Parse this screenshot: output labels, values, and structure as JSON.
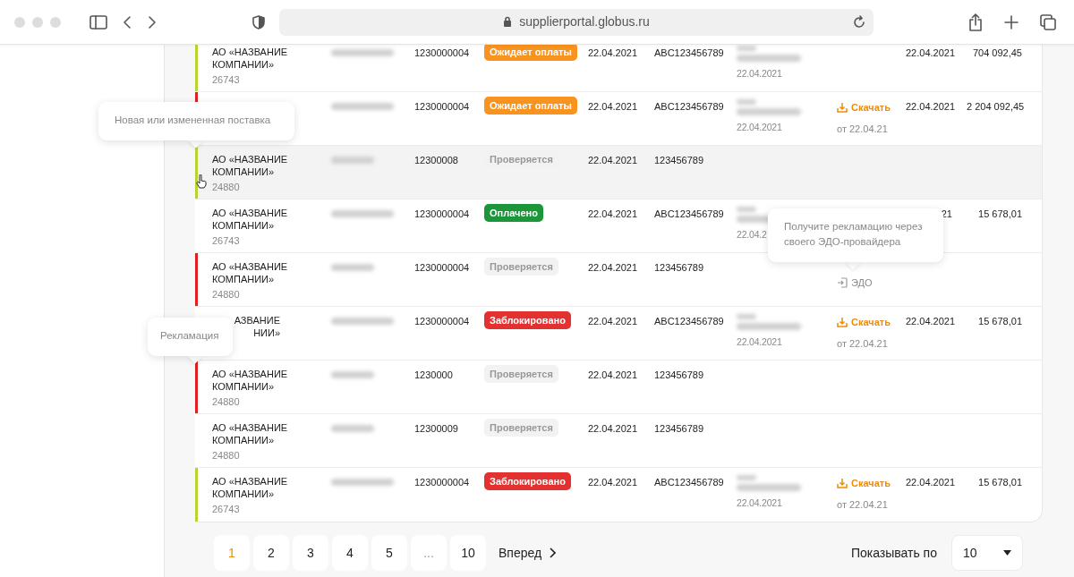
{
  "browser": {
    "url": "supplierportal.globus.ru"
  },
  "rows": [
    {
      "color": "#b7d433",
      "highlighted": false,
      "company": [
        "АО «НАЗВАНИЕ",
        "КОМПАНИИ»"
      ],
      "code": "26743",
      "column_2_redacted": true,
      "number": "1230000004",
      "status": {
        "text": "Ожидает оплаты",
        "kind": "awaiting"
      },
      "date": "22.04.2021",
      "doc": "ABC123456789",
      "column_6": {
        "redacted": true,
        "date": "22.04.2021"
      },
      "date_2": "22.04.2021",
      "amount": "704 092,45"
    },
    {
      "color": "#e02020",
      "highlighted": false,
      "column_2_redacted": true,
      "number": "1230000004",
      "status": {
        "text": "Ожидает оплаты",
        "kind": "awaiting"
      },
      "date": "22.04.2021",
      "doc": "ABC123456789",
      "column_6": {
        "redacted": true,
        "date": "22.04.2021"
      },
      "file": {
        "kind": "download",
        "text": "Скачать",
        "note": "от 22.04.21"
      },
      "date_2": "22.04.2021",
      "amount": "2 204 092,45"
    },
    {
      "color": "#b7d433",
      "highlighted": true,
      "company": [
        "АО «НАЗВАНИЕ",
        "КОМПАНИИ»"
      ],
      "code": "24880",
      "column_2_redacted": true,
      "number": "12300008",
      "status": {
        "text": "Проверяется",
        "kind": "checking"
      },
      "date": "22.04.2021",
      "doc": "123456789"
    },
    {
      "highlighted": false,
      "company": [
        "АО «НАЗВАНИЕ",
        "КОМПАНИИ»"
      ],
      "code": "26743",
      "column_2_redacted": true,
      "number": "1230000004",
      "status": {
        "text": "Оплачено",
        "kind": "paid"
      },
      "date": "22.04.2021",
      "doc": "ABC123456789",
      "column_6": {
        "redacted": true,
        "date": "22.04.2"
      },
      "date_2": "21",
      "date_2_covered": true,
      "amount": "15 678,01"
    },
    {
      "color": "#e02020",
      "highlighted": false,
      "company": [
        "АО «НАЗВАНИЕ",
        "КОМПАНИИ»"
      ],
      "code": "24880",
      "column_2_redacted": true,
      "number": "1230000004",
      "status": {
        "text": "Проверяется",
        "kind": "checking"
      },
      "date": "22.04.2021",
      "doc": "123456789",
      "file": {
        "kind": "edo",
        "text": "ЭДО"
      }
    },
    {
      "highlighted": false,
      "company": [
        "АЗВАНИЕ",
        "НИИ»"
      ],
      "company_covered": true,
      "column_2_redacted": true,
      "number": "1230000004",
      "status": {
        "text": "Заблокировано",
        "kind": "blocked"
      },
      "date": "22.04.2021",
      "doc": "ABC123456789",
      "column_6": {
        "redacted": true,
        "date": "22.04.2021"
      },
      "file": {
        "kind": "download",
        "text": "Скачать",
        "note": "от 22.04.21"
      },
      "date_2": "22.04.2021",
      "amount": "15 678,01"
    },
    {
      "color": "#e02020",
      "highlighted": false,
      "company": [
        "АО «НАЗВАНИЕ",
        "КОМПАНИИ»"
      ],
      "code": "24880",
      "column_2_redacted": true,
      "number": "1230000",
      "status": {
        "text": "Проверяется",
        "kind": "checking"
      },
      "date": "22.04.2021",
      "doc": "123456789"
    },
    {
      "highlighted": false,
      "company": [
        "АО «НАЗВАНИЕ",
        "КОМПАНИИ»"
      ],
      "code": "24880",
      "column_2_redacted": true,
      "number": "12300009",
      "status": {
        "text": "Проверяется",
        "kind": "checking"
      },
      "date": "22.04.2021",
      "doc": "123456789"
    },
    {
      "color": "#b7d433",
      "highlighted": false,
      "company": [
        "АО «НАЗВАНИЕ",
        "КОМПАНИИ»"
      ],
      "code": "26743",
      "column_2_redacted": true,
      "number": "1230000004",
      "status": {
        "text": "Заблокировано",
        "kind": "blocked"
      },
      "date": "22.04.2021",
      "doc": "ABC123456789",
      "column_6": {
        "redacted": true,
        "date": "22.04.2021"
      },
      "file": {
        "kind": "download",
        "text": "Скачать",
        "note": "от 22.04.21"
      },
      "date_2": "22.04.2021",
      "amount": "15 678,01"
    }
  ],
  "tooltips": [
    {
      "kind": "new",
      "text": "Новая или измененная поставка"
    },
    {
      "kind": "edo",
      "text": "Получите рекламацию через своего ЭДО-провайдера"
    },
    {
      "kind": "claim",
      "text": "Рекламация"
    }
  ],
  "pagination": {
    "pages": [
      {
        "label": "1",
        "selected": true
      },
      {
        "label": "2",
        "selected": false
      },
      {
        "label": "3",
        "selected": false
      },
      {
        "label": "4",
        "selected": false
      },
      {
        "label": "5",
        "selected": false
      },
      {
        "label": "...",
        "kind": "ellipsis",
        "selected": false
      },
      {
        "label": "10",
        "selected": false
      }
    ],
    "next": "Вперед",
    "per_page_label": "Показывать по",
    "per_page": "10"
  }
}
